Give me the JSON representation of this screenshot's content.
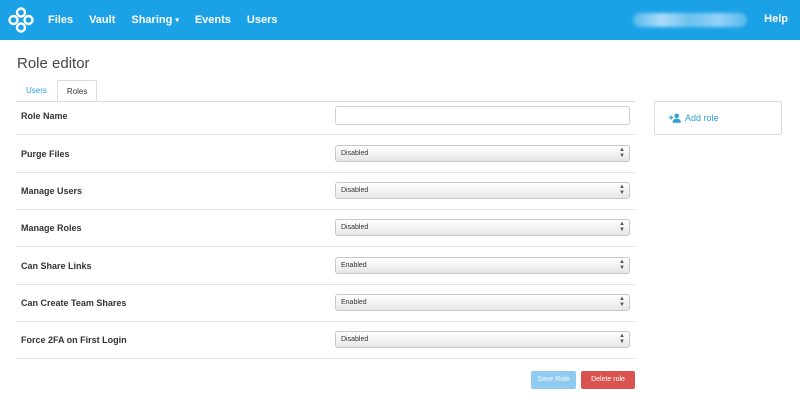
{
  "nav": {
    "links": [
      "Files",
      "Vault",
      "Sharing",
      "Events",
      "Users"
    ],
    "help": "Help",
    "caret": "▾"
  },
  "page": {
    "title": "Role editor"
  },
  "tabs": [
    "Users",
    "Roles"
  ],
  "form": {
    "rows": [
      {
        "label": "Role Name",
        "value": ""
      },
      {
        "label": "Purge Files",
        "value": "Disabled"
      },
      {
        "label": "Manage Users",
        "value": "Disabled"
      },
      {
        "label": "Manage Roles",
        "value": "Disabled"
      },
      {
        "label": "Can Share Links",
        "value": "Enabled"
      },
      {
        "label": "Can Create Team Shares",
        "value": "Enabled"
      },
      {
        "label": "Force 2FA on First Login",
        "value": "Disabled"
      }
    ],
    "arrow_up": "▲",
    "arrow_down": "▼"
  },
  "buttons": {
    "save": "Save Role",
    "delete": "Delete role"
  },
  "sidebar": {
    "add_role": "Add role"
  },
  "colors": {
    "nav_bg": "#1ba2e6",
    "link": "#2a9fd8",
    "save": "#8fcbf0",
    "delete": "#d9534f"
  },
  "icons": [
    "app-logo-icon",
    "chevron-down-icon",
    "sort-arrows-icon",
    "add-user-icon"
  ]
}
